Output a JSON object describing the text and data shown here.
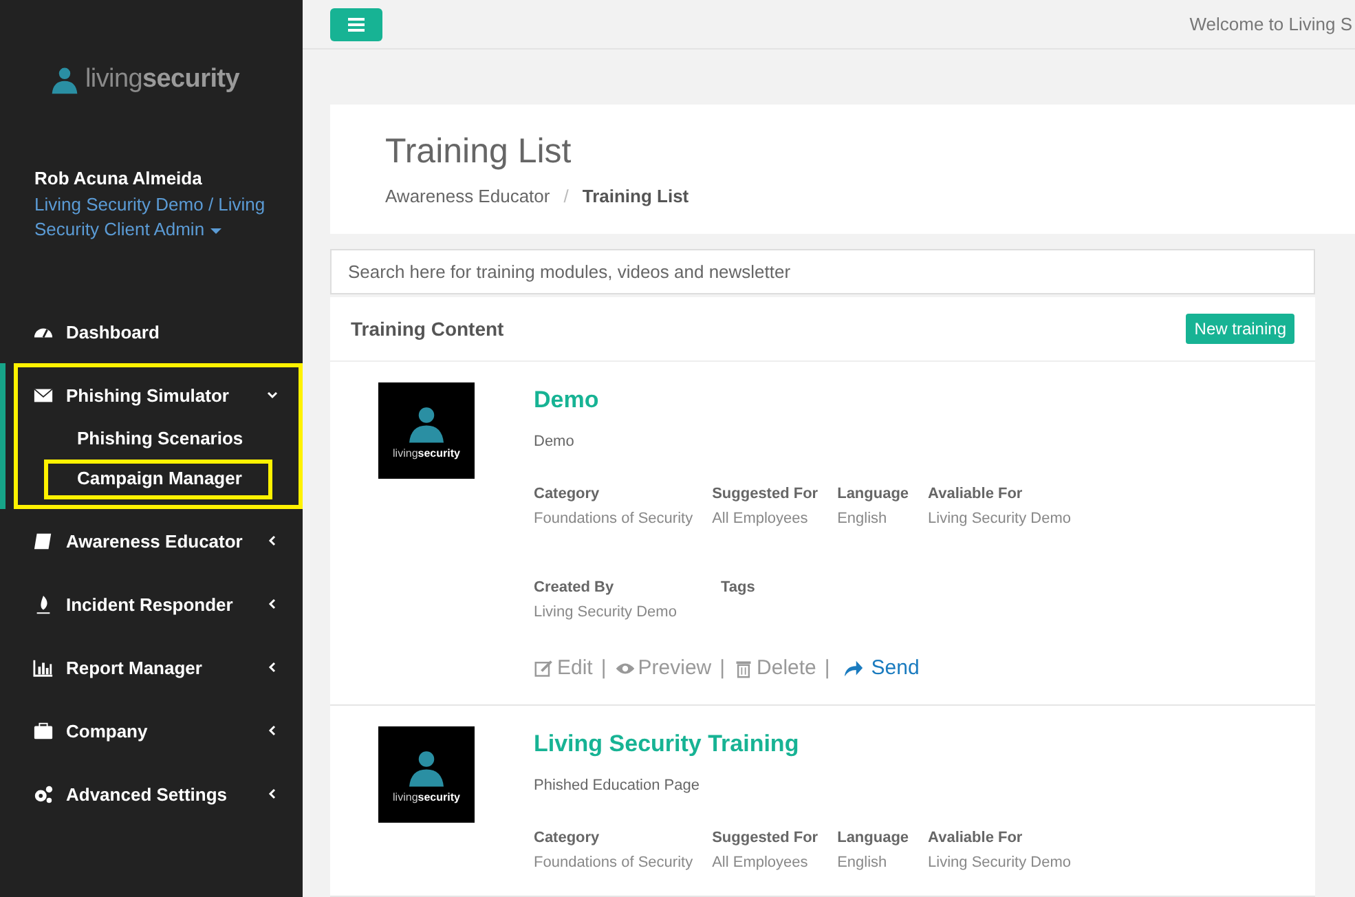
{
  "sidebar": {
    "logo": {
      "light": "living",
      "bold": "security"
    },
    "user": {
      "name": "Rob Acuna Almeida",
      "role": "Living Security Demo / Living Security Client Admin"
    },
    "items": [
      {
        "kind": "dashboard",
        "label": "Dashboard",
        "expandable": false,
        "selected": false,
        "highlighted": false
      },
      {
        "kind": "envelope",
        "label": "Phishing Simulator",
        "expandable": true,
        "expanded": true,
        "selected": true,
        "highlighted": true,
        "children": [
          {
            "label": "Phishing Scenarios",
            "highlighted": false
          },
          {
            "label": "Campaign Manager",
            "highlighted": true
          }
        ]
      },
      {
        "kind": "book",
        "label": "Awareness Educator",
        "expandable": true,
        "expanded": false,
        "selected": false,
        "highlighted": false
      },
      {
        "kind": "fire",
        "label": "Incident Responder",
        "expandable": true,
        "expanded": false,
        "selected": false,
        "highlighted": false
      },
      {
        "kind": "chart",
        "label": "Report Manager",
        "expandable": true,
        "expanded": false,
        "selected": false,
        "highlighted": false
      },
      {
        "kind": "briefcase",
        "label": "Company",
        "expandable": true,
        "expanded": false,
        "selected": false,
        "highlighted": false
      },
      {
        "kind": "gears",
        "label": "Advanced Settings",
        "expandable": true,
        "expanded": false,
        "selected": false,
        "highlighted": false
      }
    ]
  },
  "topbar": {
    "welcome": "Welcome to Living S"
  },
  "page_header": {
    "title": "Training List",
    "breadcrumb": [
      {
        "label": "Awareness Educator",
        "current": false
      },
      {
        "label": "Training List",
        "current": true
      }
    ],
    "separator": "/"
  },
  "search": {
    "placeholder": "Search here for training modules, videos and newsletter"
  },
  "panel": {
    "title": "Training Content",
    "new_button": "New training",
    "trainings": [
      {
        "thumbnail_text": {
          "light": "living",
          "bold": "security"
        },
        "title": "Demo",
        "subtitle": "Demo",
        "field_rows": [
          [
            {
              "label": "Category",
              "value": "Foundations of Security"
            },
            {
              "label": "Suggested For",
              "value": "All Employees"
            },
            {
              "label": "Language",
              "value": "English"
            },
            {
              "label": "Avaliable For",
              "value": "Living Security Demo"
            }
          ],
          [
            {
              "label": "Created By",
              "value": "Living Security Demo"
            },
            {
              "label": "Tags"
            }
          ]
        ],
        "actions": [
          {
            "kind": "edit",
            "label": "Edit"
          },
          {
            "kind": "separator",
            "label": "|"
          },
          {
            "kind": "preview",
            "label": "Preview"
          },
          {
            "kind": "separator",
            "label": "|"
          },
          {
            "kind": "delete",
            "label": "Delete"
          },
          {
            "kind": "separator",
            "label": "|"
          },
          {
            "kind": "send",
            "label": "Send"
          }
        ]
      },
      {
        "thumbnail_text": {
          "light": "living",
          "bold": "security"
        },
        "title": "Living Security Training",
        "subtitle": "Phished Education Page",
        "field_rows": [
          [
            {
              "label": "Category",
              "value": "Foundations of Security"
            },
            {
              "label": "Suggested For",
              "value": "All Employees"
            },
            {
              "label": "Language",
              "value": "English"
            },
            {
              "label": "Avaliable For",
              "value": "Living Security Demo"
            }
          ]
        ]
      }
    ]
  }
}
